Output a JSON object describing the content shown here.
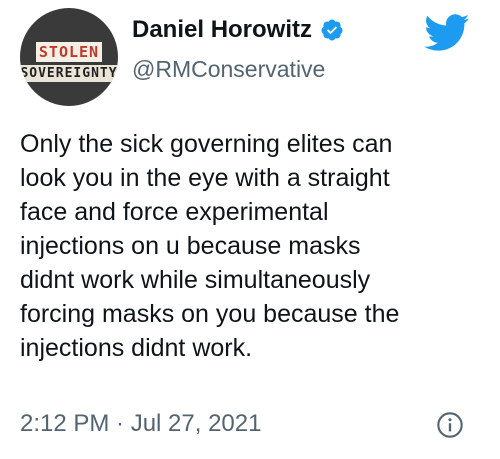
{
  "author": {
    "display_name": "Daniel Horowitz",
    "handle": "@RMConservative",
    "verified": true,
    "avatar_logo_line1": "STOLEN",
    "avatar_logo_line2": "SOVEREIGNTY"
  },
  "tweet": {
    "text": "Only the sick governing elites can\nlook you in the eye with a straight\nface and force experimental\ninjections on u because masks\ndidnt work while simultaneously\nforcing masks on you because the\ninjections didnt work.",
    "timestamp": "2:12 PM · Jul 27, 2021"
  },
  "icons": {
    "brand": "twitter-bird-icon",
    "verified": "verified-badge-icon",
    "info": "info-icon"
  },
  "colors": {
    "twitter_blue": "#1d9bf0",
    "text_primary": "#0f1419",
    "text_secondary": "#536471"
  }
}
